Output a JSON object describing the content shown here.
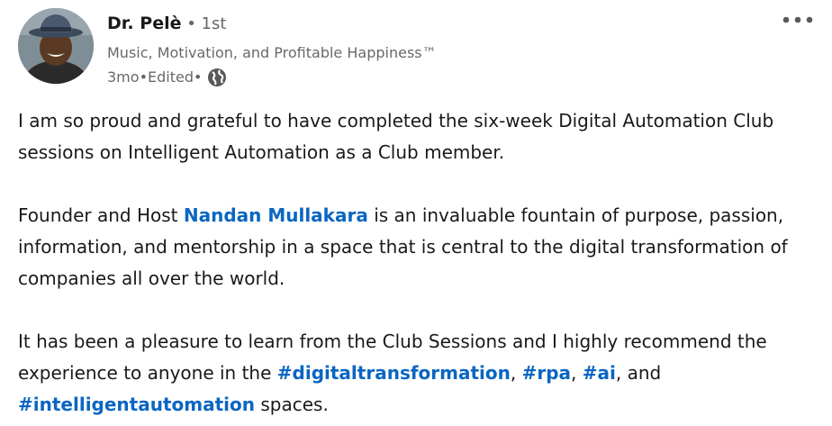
{
  "author": {
    "name": "Dr. Pelè",
    "degree_separator": " • ",
    "degree": "1st",
    "headline": "Music, Motivation, and Profitable Happiness™",
    "time": "3mo",
    "edited": "Edited",
    "separator": " • ",
    "visibility_icon": "globe-icon"
  },
  "menu_icon": "more-horizontal-icon",
  "body": {
    "p1": "I am so proud and grateful to have completed the six-week Digital Automation Club sessions on Intelligent Automation as a Club member.",
    "p2_before": "Founder and Host ",
    "p2_mention": "Nandan Mullakara",
    "p2_after": " is an invaluable fountain of purpose, passion, information, and mentorship in a space that is central to the digital transformation of companies all over the world.",
    "p3_before": "It has been a pleasure to learn from the Club Sessions and I highly recommend the experience to anyone in the ",
    "hashtag1": "#digitaltransformation",
    "comma1": ", ",
    "hashtag2": "#rpa",
    "comma2": ", ",
    "hashtag3": "#ai",
    "and_text": ", and ",
    "hashtag4": "#intelligentautomation",
    "p3_after": " spaces."
  },
  "colors": {
    "link": "#0a66c2",
    "text": "#000000e6",
    "secondary": "#00000099"
  }
}
